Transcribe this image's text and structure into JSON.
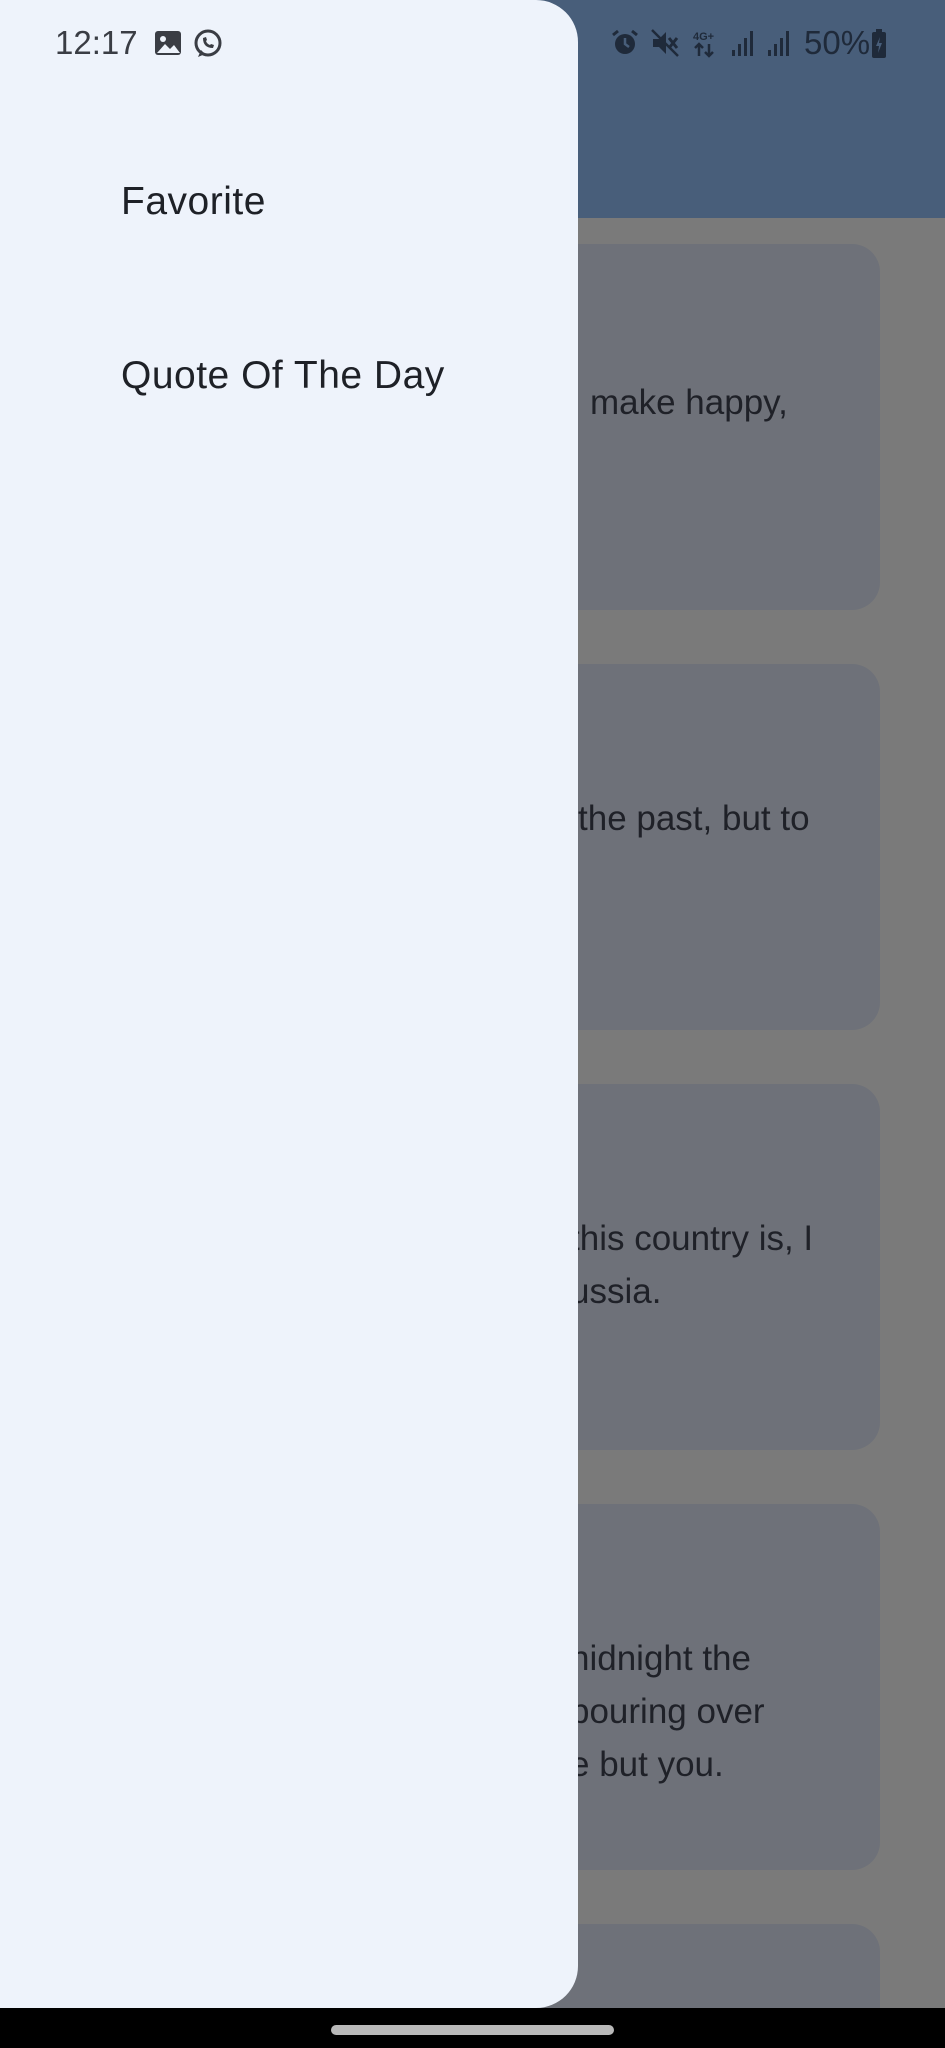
{
  "status_bar": {
    "time": "12:17",
    "battery": "50%",
    "left_icons": [
      "gallery-icon",
      "whatsapp-icon"
    ],
    "right_icons": [
      "alarm-icon",
      "mute-icon",
      "network-4g-icon",
      "signal-icon",
      "signal-icon",
      "battery-icon"
    ]
  },
  "drawer": {
    "items": [
      {
        "label": "Favorite"
      },
      {
        "label": "Quote Of The Day"
      }
    ]
  },
  "background_cards": [
    {
      "text": "make happy,"
    },
    {
      "text": "the past, but to"
    },
    {
      "text": "this country is, I\nussia."
    },
    {
      "text": "nidnight the\npouring over\ne but you."
    }
  ],
  "colors": {
    "app_bar": "#485e7a",
    "drawer_bg": "#eef3fb",
    "scrim_bg": "#7a7a7a",
    "card_bg": "#6e7179"
  }
}
